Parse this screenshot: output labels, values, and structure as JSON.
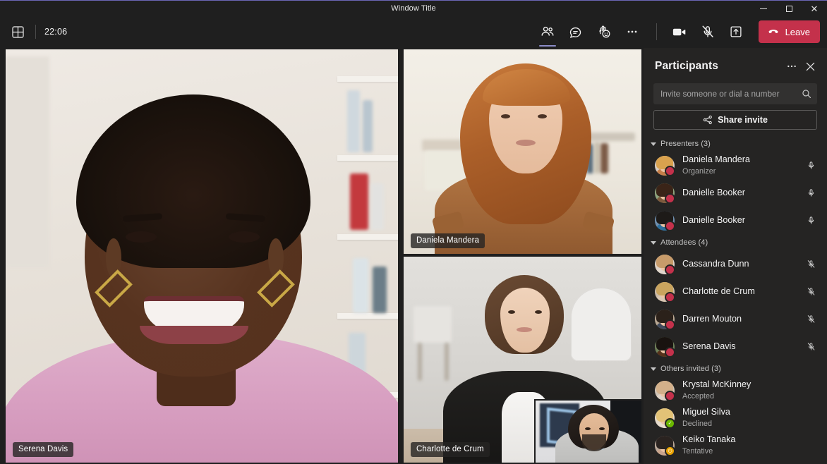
{
  "window": {
    "title": "Window Title",
    "minimize_label": "Minimize",
    "maximize_label": "Maximize",
    "close_label": "Close"
  },
  "toolbar": {
    "grid_icon": "grid-view-icon",
    "clock": "22:06",
    "buttons": [
      {
        "name": "people-icon",
        "label": "Show participants",
        "active": true
      },
      {
        "name": "chat-icon",
        "label": "Show conversation",
        "active": false
      },
      {
        "name": "reactions-icon",
        "label": "Reactions",
        "active": false
      },
      {
        "name": "more-icon",
        "label": "More actions",
        "active": false
      }
    ],
    "media": [
      {
        "name": "camera-icon",
        "label": "Camera"
      },
      {
        "name": "microphone-muted-icon",
        "label": "Mic muted"
      },
      {
        "name": "share-screen-icon",
        "label": "Share content"
      }
    ],
    "leave": {
      "label": "Leave",
      "color": "#c4314b",
      "icon": "hangup-icon"
    }
  },
  "stage": {
    "tiles": [
      {
        "name": "Serena Davis",
        "position": "main"
      },
      {
        "name": "Daniela Mandera",
        "position": "top-right"
      },
      {
        "name": "Charlotte de Crum",
        "position": "bottom-right"
      }
    ],
    "pip": {
      "name": "pip-video",
      "label": ""
    }
  },
  "panel": {
    "title": "Participants",
    "more_icon": "more-icon",
    "close_icon": "close-icon",
    "search": {
      "placeholder": "Invite someone or dial a number",
      "value": "",
      "icon": "search-icon"
    },
    "share_invite": {
      "label": "Share invite",
      "icon": "share-link-icon"
    },
    "sections": [
      {
        "title": "Presenters (3)",
        "people": [
          {
            "name": "Daniela Mandera",
            "sub": "Organizer",
            "mic": "mic-on",
            "presence": "busy",
            "hair": "#d9a24e",
            "bodycolor": "#c67f4a",
            "bg": "#d7ccc2"
          },
          {
            "name": "Danielle Booker",
            "sub": "",
            "mic": "mic-on",
            "presence": "busy",
            "hair": "#3a2418",
            "bodycolor": "#7e5a3d",
            "bg": "#8fa47e"
          },
          {
            "name": "Danielle Booker",
            "sub": "",
            "mic": "mic-on",
            "presence": "busy",
            "hair": "#1d1a18",
            "bodycolor": "#2c6f9c",
            "bg": "#6f8fae"
          }
        ]
      },
      {
        "title": "Attendees (4)",
        "people": [
          {
            "name": "Cassandra Dunn",
            "sub": "",
            "mic": "mic-off",
            "presence": "busy",
            "hair": "#c79b6a",
            "bodycolor": "#e0d6cc",
            "bg": "#ded2c6"
          },
          {
            "name": "Charlotte de Crum",
            "sub": "",
            "mic": "mic-off",
            "presence": "busy",
            "hair": "#c9a45e",
            "bodycolor": "#d8c6b2",
            "bg": "#cbbba8"
          },
          {
            "name": "Darren Mouton",
            "sub": "",
            "mic": "mic-off",
            "presence": "busy",
            "hair": "#2b211a",
            "bodycolor": "#404a5c",
            "bg": "#b9a894"
          },
          {
            "name": "Serena Davis",
            "sub": "",
            "mic": "mic-off",
            "presence": "busy",
            "hair": "#191310",
            "bodycolor": "#57321c",
            "bg": "#6f7f59"
          }
        ]
      },
      {
        "title": "Others invited (3)",
        "people": [
          {
            "name": "Krystal McKinney",
            "sub": "Accepted",
            "mic": "",
            "presence": "busy",
            "hair": "#d3b08a",
            "bodycolor": "#ded2c6",
            "bg": "#cfc3b6"
          },
          {
            "name": "Miguel Silva",
            "sub": "Declined",
            "mic": "",
            "presence": "available",
            "hair": "#e2c277",
            "bodycolor": "#e6dbcd",
            "bg": "#e3d8c9"
          },
          {
            "name": "Keiko Tanaka",
            "sub": "Tentative",
            "mic": "",
            "presence": "away",
            "hair": "#2a2320",
            "bodycolor": "#caa58d",
            "bg": "#b9a799"
          }
        ]
      }
    ],
    "presence_colors": {
      "busy": "#c4314b",
      "available": "#6bb700",
      "away": "#eaa300"
    }
  }
}
